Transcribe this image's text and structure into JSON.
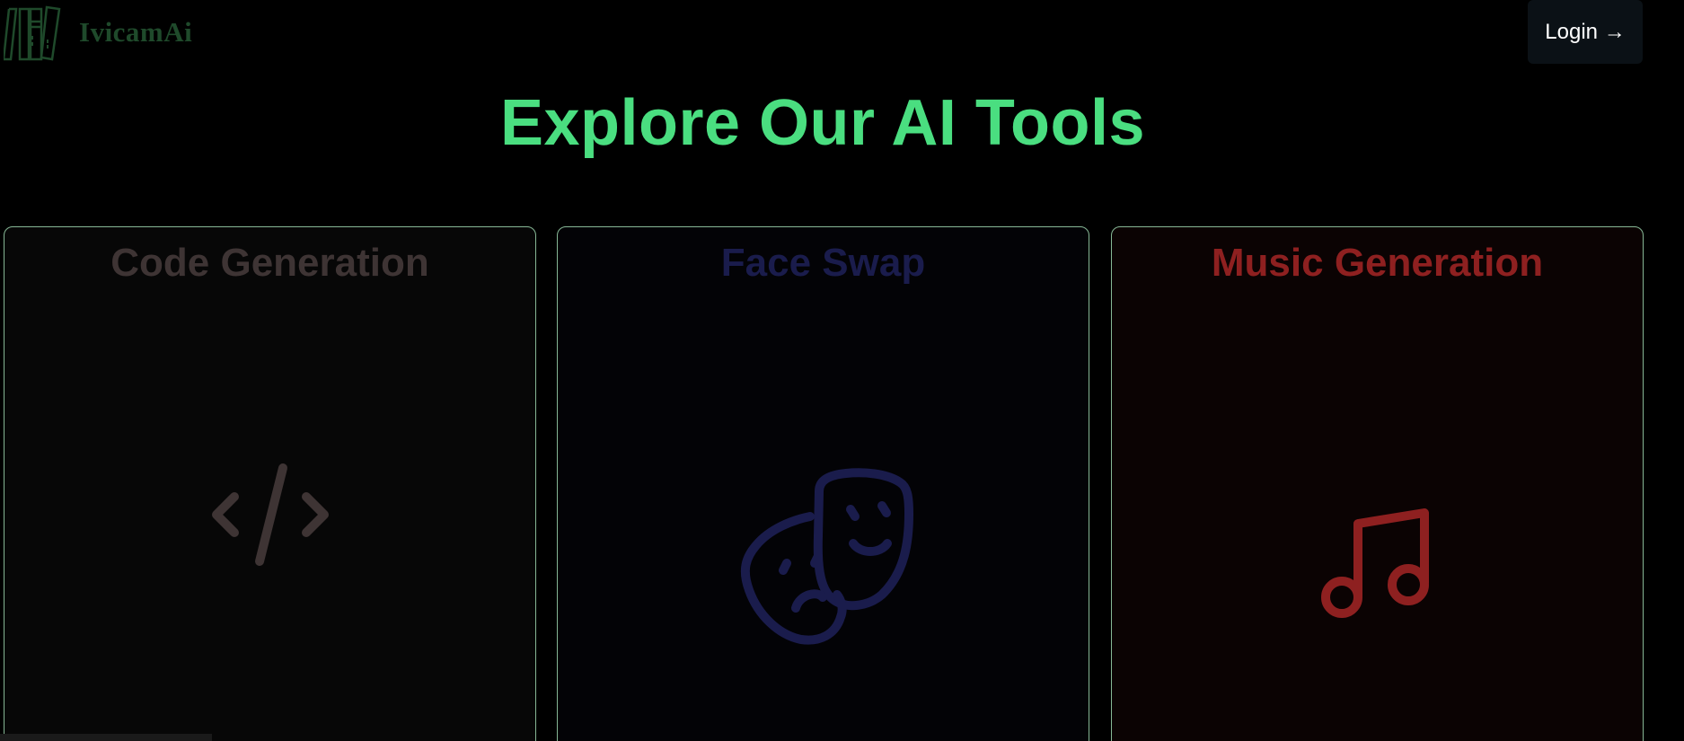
{
  "header": {
    "logo_text": "IvicamAi",
    "login_label": "Login →"
  },
  "main": {
    "title": "Explore Our AI Tools"
  },
  "cards": [
    {
      "title": "Code Generation",
      "icon": "code-icon",
      "color": "#3e3434"
    },
    {
      "title": "Face Swap",
      "icon": "theater-masks-icon",
      "color": "#1a1c4c"
    },
    {
      "title": "Music Generation",
      "icon": "music-note-icon",
      "color": "#8e2020"
    }
  ],
  "colors": {
    "accent": "#4ade80",
    "background": "#000000",
    "card_border": "#86b795",
    "logo": "#1f4a2b",
    "login_bg": "#0b1116"
  }
}
